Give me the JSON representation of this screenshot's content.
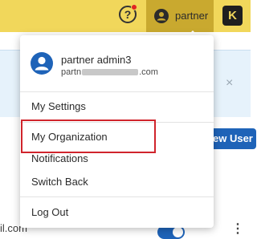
{
  "topbar": {
    "help_glyph": "?",
    "user_name": "partner",
    "brand_logo_text": "K",
    "accent_color": "#f1d75b",
    "active_color": "#c9a92f"
  },
  "background": {
    "banner_close": "×",
    "new_user_label": "ew User",
    "row_text": "il.com",
    "row_more": "⋮"
  },
  "dropdown": {
    "profile_name": "partner admin3",
    "profile_email_prefix": "partn",
    "profile_email_suffix": ".com",
    "items": [
      {
        "label": "My Settings"
      },
      {
        "label": "My Organization"
      },
      {
        "label": "Notifications"
      },
      {
        "label": "Switch Back"
      },
      {
        "label": "Log Out"
      }
    ]
  }
}
